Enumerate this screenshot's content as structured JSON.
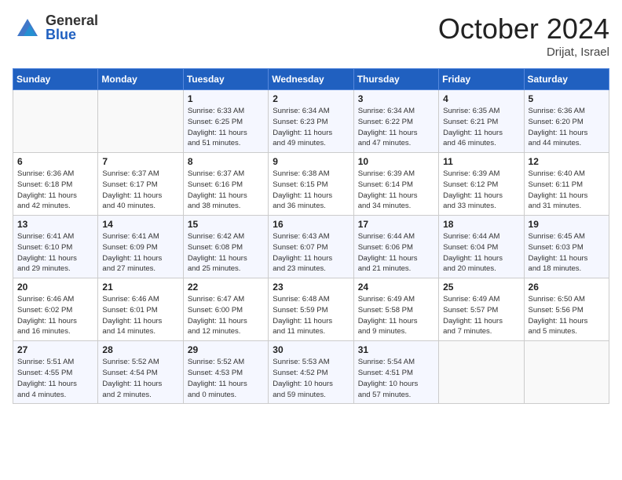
{
  "header": {
    "logo_general": "General",
    "logo_blue": "Blue",
    "month_title": "October 2024",
    "location": "Drijat, Israel"
  },
  "weekdays": [
    "Sunday",
    "Monday",
    "Tuesday",
    "Wednesday",
    "Thursday",
    "Friday",
    "Saturday"
  ],
  "weeks": [
    [
      {
        "day": "",
        "info": ""
      },
      {
        "day": "",
        "info": ""
      },
      {
        "day": "1",
        "info": "Sunrise: 6:33 AM\nSunset: 6:25 PM\nDaylight: 11 hours\nand 51 minutes."
      },
      {
        "day": "2",
        "info": "Sunrise: 6:34 AM\nSunset: 6:23 PM\nDaylight: 11 hours\nand 49 minutes."
      },
      {
        "day": "3",
        "info": "Sunrise: 6:34 AM\nSunset: 6:22 PM\nDaylight: 11 hours\nand 47 minutes."
      },
      {
        "day": "4",
        "info": "Sunrise: 6:35 AM\nSunset: 6:21 PM\nDaylight: 11 hours\nand 46 minutes."
      },
      {
        "day": "5",
        "info": "Sunrise: 6:36 AM\nSunset: 6:20 PM\nDaylight: 11 hours\nand 44 minutes."
      }
    ],
    [
      {
        "day": "6",
        "info": "Sunrise: 6:36 AM\nSunset: 6:18 PM\nDaylight: 11 hours\nand 42 minutes."
      },
      {
        "day": "7",
        "info": "Sunrise: 6:37 AM\nSunset: 6:17 PM\nDaylight: 11 hours\nand 40 minutes."
      },
      {
        "day": "8",
        "info": "Sunrise: 6:37 AM\nSunset: 6:16 PM\nDaylight: 11 hours\nand 38 minutes."
      },
      {
        "day": "9",
        "info": "Sunrise: 6:38 AM\nSunset: 6:15 PM\nDaylight: 11 hours\nand 36 minutes."
      },
      {
        "day": "10",
        "info": "Sunrise: 6:39 AM\nSunset: 6:14 PM\nDaylight: 11 hours\nand 34 minutes."
      },
      {
        "day": "11",
        "info": "Sunrise: 6:39 AM\nSunset: 6:12 PM\nDaylight: 11 hours\nand 33 minutes."
      },
      {
        "day": "12",
        "info": "Sunrise: 6:40 AM\nSunset: 6:11 PM\nDaylight: 11 hours\nand 31 minutes."
      }
    ],
    [
      {
        "day": "13",
        "info": "Sunrise: 6:41 AM\nSunset: 6:10 PM\nDaylight: 11 hours\nand 29 minutes."
      },
      {
        "day": "14",
        "info": "Sunrise: 6:41 AM\nSunset: 6:09 PM\nDaylight: 11 hours\nand 27 minutes."
      },
      {
        "day": "15",
        "info": "Sunrise: 6:42 AM\nSunset: 6:08 PM\nDaylight: 11 hours\nand 25 minutes."
      },
      {
        "day": "16",
        "info": "Sunrise: 6:43 AM\nSunset: 6:07 PM\nDaylight: 11 hours\nand 23 minutes."
      },
      {
        "day": "17",
        "info": "Sunrise: 6:44 AM\nSunset: 6:06 PM\nDaylight: 11 hours\nand 21 minutes."
      },
      {
        "day": "18",
        "info": "Sunrise: 6:44 AM\nSunset: 6:04 PM\nDaylight: 11 hours\nand 20 minutes."
      },
      {
        "day": "19",
        "info": "Sunrise: 6:45 AM\nSunset: 6:03 PM\nDaylight: 11 hours\nand 18 minutes."
      }
    ],
    [
      {
        "day": "20",
        "info": "Sunrise: 6:46 AM\nSunset: 6:02 PM\nDaylight: 11 hours\nand 16 minutes."
      },
      {
        "day": "21",
        "info": "Sunrise: 6:46 AM\nSunset: 6:01 PM\nDaylight: 11 hours\nand 14 minutes."
      },
      {
        "day": "22",
        "info": "Sunrise: 6:47 AM\nSunset: 6:00 PM\nDaylight: 11 hours\nand 12 minutes."
      },
      {
        "day": "23",
        "info": "Sunrise: 6:48 AM\nSunset: 5:59 PM\nDaylight: 11 hours\nand 11 minutes."
      },
      {
        "day": "24",
        "info": "Sunrise: 6:49 AM\nSunset: 5:58 PM\nDaylight: 11 hours\nand 9 minutes."
      },
      {
        "day": "25",
        "info": "Sunrise: 6:49 AM\nSunset: 5:57 PM\nDaylight: 11 hours\nand 7 minutes."
      },
      {
        "day": "26",
        "info": "Sunrise: 6:50 AM\nSunset: 5:56 PM\nDaylight: 11 hours\nand 5 minutes."
      }
    ],
    [
      {
        "day": "27",
        "info": "Sunrise: 5:51 AM\nSunset: 4:55 PM\nDaylight: 11 hours\nand 4 minutes."
      },
      {
        "day": "28",
        "info": "Sunrise: 5:52 AM\nSunset: 4:54 PM\nDaylight: 11 hours\nand 2 minutes."
      },
      {
        "day": "29",
        "info": "Sunrise: 5:52 AM\nSunset: 4:53 PM\nDaylight: 11 hours\nand 0 minutes."
      },
      {
        "day": "30",
        "info": "Sunrise: 5:53 AM\nSunset: 4:52 PM\nDaylight: 10 hours\nand 59 minutes."
      },
      {
        "day": "31",
        "info": "Sunrise: 5:54 AM\nSunset: 4:51 PM\nDaylight: 10 hours\nand 57 minutes."
      },
      {
        "day": "",
        "info": ""
      },
      {
        "day": "",
        "info": ""
      }
    ]
  ]
}
